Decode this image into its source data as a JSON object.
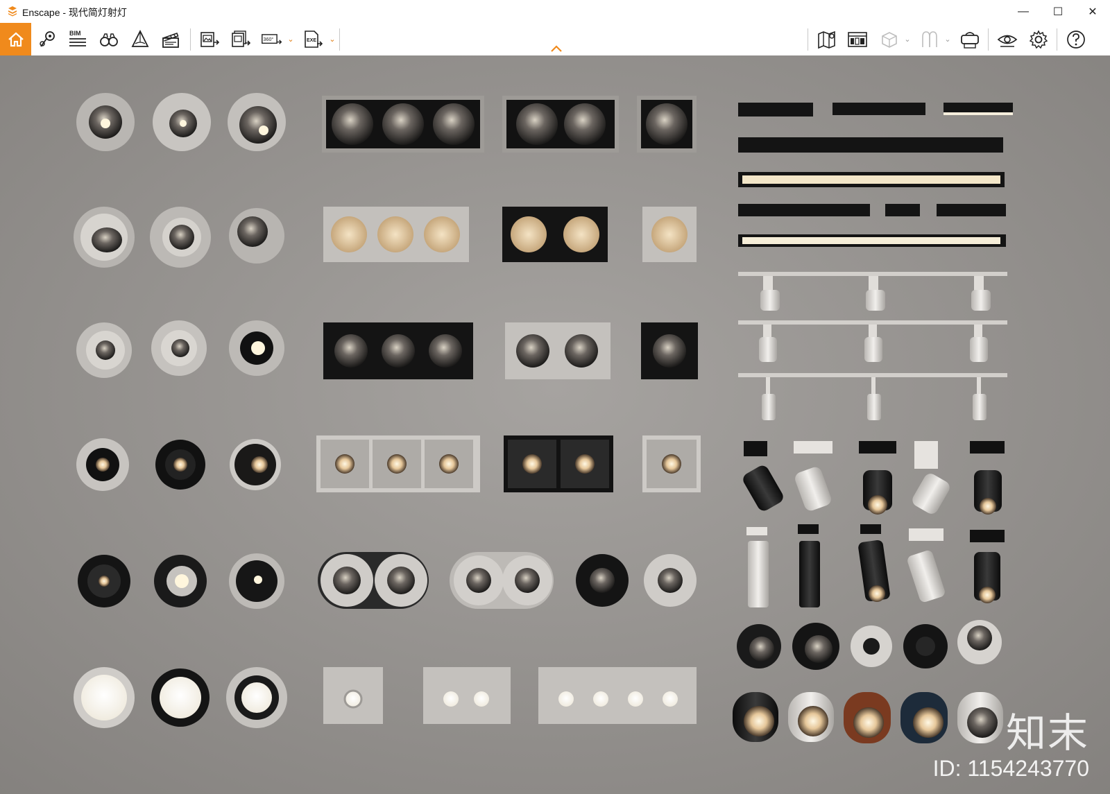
{
  "window": {
    "app_name": "Enscape",
    "title": "Enscape - 现代简灯射灯",
    "controls": {
      "minimize": "—",
      "maximize": "☐",
      "close": "✕"
    }
  },
  "toolbar": {
    "bim_label": "BIM",
    "left_tools": [
      {
        "name": "home-button",
        "icon": "house-icon"
      },
      {
        "name": "location-button",
        "icon": "map-pin-icon"
      },
      {
        "name": "bim-button",
        "icon": "bim-list-icon"
      },
      {
        "name": "views-button",
        "icon": "binoculars-icon"
      },
      {
        "name": "atmosphere-button",
        "icon": "cone-icon"
      },
      {
        "name": "video-editor-button",
        "icon": "clapperboard-icon"
      },
      {
        "name": "screenshot-button",
        "icon": "image-export-icon"
      },
      {
        "name": "batch-render-button",
        "icon": "batch-export-icon"
      },
      {
        "name": "panorama-button",
        "icon": "panorama-360-icon",
        "label": "360°"
      },
      {
        "name": "exe-export-button",
        "icon": "exe-export-icon",
        "label": "EXE"
      }
    ],
    "right_tools": [
      {
        "name": "map-button",
        "icon": "map-icon"
      },
      {
        "name": "asset-library-button",
        "icon": "asset-library-icon"
      },
      {
        "name": "cube-button",
        "icon": "cube-icon"
      },
      {
        "name": "material-button",
        "icon": "material-icon"
      },
      {
        "name": "vr-button",
        "icon": "vr-headset-icon"
      },
      {
        "name": "visual-settings-button",
        "icon": "eye-icon"
      },
      {
        "name": "settings-button",
        "icon": "gear-icon"
      },
      {
        "name": "help-button",
        "icon": "help-icon"
      }
    ]
  },
  "watermark": {
    "logo": "知末",
    "id_text": "ID: 1154243770"
  },
  "colors": {
    "accent": "#f08a1c",
    "wall": "#8f8c89",
    "fixture_white": "#d9d6d2",
    "fixture_black": "#1c1c1c"
  }
}
